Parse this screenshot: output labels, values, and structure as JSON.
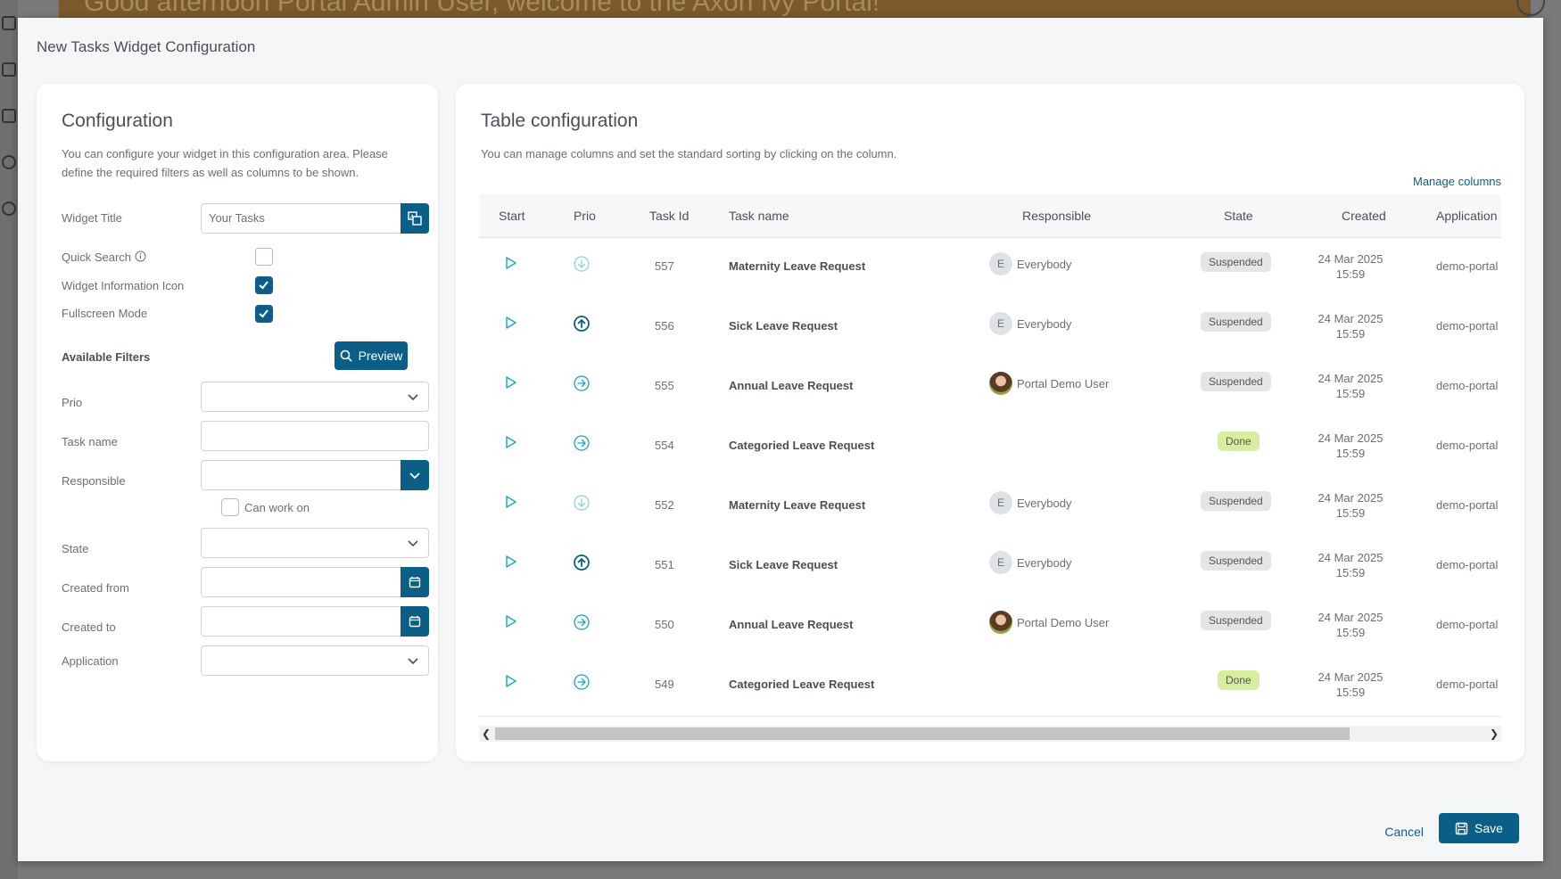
{
  "background": {
    "banner_text": "Good afternoon Portal Admin User, welcome to the Axon Ivy Portal!"
  },
  "dialog": {
    "title": "New Tasks Widget Configuration"
  },
  "config": {
    "heading": "Configuration",
    "description_line1": "You can configure your widget in this configuration area. Please",
    "description_line2": "define the required filters as well as columns to be shown.",
    "widget_title_label": "Widget Title",
    "widget_title_value": "Your Tasks",
    "quick_search_label": "Quick Search",
    "quick_search_checked": false,
    "widget_info_label": "Widget Information Icon",
    "widget_info_checked": true,
    "fullscreen_label": "Fullscreen Mode",
    "fullscreen_checked": true,
    "filters_heading": "Available Filters",
    "preview_label": "Preview",
    "prio_label": "Prio",
    "prio_value": "",
    "task_name_label": "Task name",
    "task_name_value": "",
    "responsible_label": "Responsible",
    "responsible_value": "",
    "can_work_on_label": "Can work on",
    "can_work_on_checked": false,
    "state_label": "State",
    "state_value": "",
    "created_from_label": "Created from",
    "created_from_value": "",
    "created_to_label": "Created to",
    "created_to_value": "",
    "application_label": "Application",
    "application_value": ""
  },
  "table_config": {
    "heading": "Table configuration",
    "description": "You can manage columns and set the standard sorting by clicking on the column.",
    "manage_columns_label": "Manage columns",
    "columns": [
      "Start",
      "Prio",
      "Task Id",
      "Task name",
      "Responsible",
      "State",
      "Created",
      "Application"
    ],
    "rows": [
      {
        "prio": "low",
        "id": "557",
        "name": "Maternity Leave Request",
        "responsible": "Everybody",
        "resp_type": "role",
        "resp_initial": "E",
        "state": "Suspended",
        "date": "24 Mar 2025",
        "time": "15:59",
        "app": "demo-portal"
      },
      {
        "prio": "high",
        "id": "556",
        "name": "Sick Leave Request",
        "responsible": "Everybody",
        "resp_type": "role",
        "resp_initial": "E",
        "state": "Suspended",
        "date": "24 Mar 2025",
        "time": "15:59",
        "app": "demo-portal"
      },
      {
        "prio": "normal",
        "id": "555",
        "name": "Annual Leave Request",
        "responsible": "Portal Demo User",
        "resp_type": "user",
        "resp_initial": "",
        "state": "Suspended",
        "date": "24 Mar 2025",
        "time": "15:59",
        "app": "demo-portal"
      },
      {
        "prio": "normal",
        "id": "554",
        "name": "Categoried Leave Request",
        "responsible": "",
        "resp_type": "none",
        "resp_initial": "",
        "state": "Done",
        "date": "24 Mar 2025",
        "time": "15:59",
        "app": "demo-portal"
      },
      {
        "prio": "low",
        "id": "552",
        "name": "Maternity Leave Request",
        "responsible": "Everybody",
        "resp_type": "role",
        "resp_initial": "E",
        "state": "Suspended",
        "date": "24 Mar 2025",
        "time": "15:59",
        "app": "demo-portal"
      },
      {
        "prio": "high",
        "id": "551",
        "name": "Sick Leave Request",
        "responsible": "Everybody",
        "resp_type": "role",
        "resp_initial": "E",
        "state": "Suspended",
        "date": "24 Mar 2025",
        "time": "15:59",
        "app": "demo-portal"
      },
      {
        "prio": "normal",
        "id": "550",
        "name": "Annual Leave Request",
        "responsible": "Portal Demo User",
        "resp_type": "user",
        "resp_initial": "",
        "state": "Suspended",
        "date": "24 Mar 2025",
        "time": "15:59",
        "app": "demo-portal"
      },
      {
        "prio": "normal",
        "id": "549",
        "name": "Categoried Leave Request",
        "responsible": "",
        "resp_type": "none",
        "resp_initial": "",
        "state": "Done",
        "date": "24 Mar 2025",
        "time": "15:59",
        "app": "demo-portal"
      }
    ]
  },
  "footer": {
    "cancel_label": "Cancel",
    "save_label": "Save"
  },
  "colors": {
    "primary": "#0b5e86",
    "accent_icon": "#1aa3c8",
    "done_badge": "#d8ee9e",
    "suspended_badge": "#e3e5e7"
  }
}
